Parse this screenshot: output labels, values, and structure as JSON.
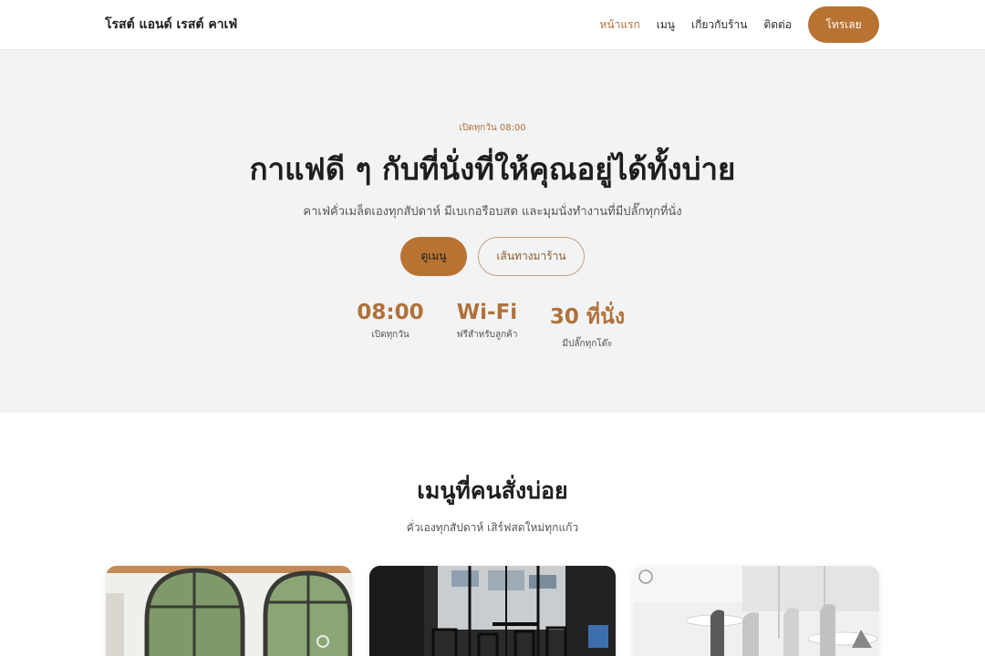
{
  "header": {
    "brand": "โรสต์ แอนด์ เรสต์ คาเฟ่",
    "nav": [
      {
        "label": "หน้าแรก",
        "active": true
      },
      {
        "label": "เมนู",
        "active": false
      },
      {
        "label": "เกี่ยวกับร้าน",
        "active": false
      },
      {
        "label": "ติดต่อ",
        "active": false
      }
    ],
    "call_label": "โทรเลย"
  },
  "hero": {
    "eyebrow": "เปิดทุกวัน 08:00",
    "title": "กาแฟดี ๆ กับที่นั่งที่ให้คุณอยู่ได้ทั้งบ่าย",
    "subtitle": "คาเฟ่คั่วเมล็ดเองทุกสัปดาห์ มีเบเกอรีอบสด และมุมนั่งทำงานที่มีปลั๊กทุกที่นั่ง",
    "primary_button": "ดูเมนู",
    "secondary_button": "เส้นทางมาร้าน",
    "stats": [
      {
        "value": "08:00",
        "label": "เปิดทุกวัน"
      },
      {
        "value": "Wi-Fi",
        "label": "ฟรีสำหรับลูกค้า"
      },
      {
        "value": "30 ที่นั่ง",
        "label": "มีปลั๊กทุกโต๊ะ"
      }
    ]
  },
  "menu_section": {
    "title": "เมนูที่คนสั่งบ่อย",
    "subtitle": "คั่วเองทุกสัปดาห์ เสิร์ฟสดใหม่ทุกแก้ว"
  },
  "colors": {
    "accent": "#b87333",
    "accent_text": "#b0713a",
    "hero_bg": "#f2f3f4"
  }
}
